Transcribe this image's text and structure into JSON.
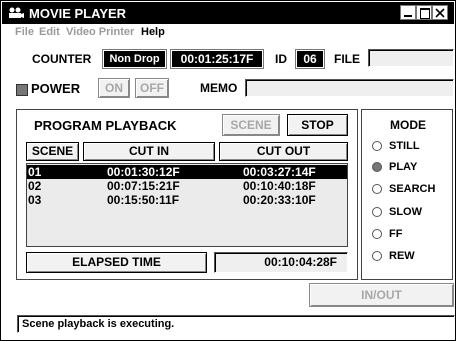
{
  "window": {
    "title": "MOVIE PLAYER"
  },
  "menu": {
    "file": "File",
    "edit": "Edit",
    "video_printer": "Video Printer",
    "help": "Help"
  },
  "counter": {
    "label": "COUNTER",
    "mode": "Non Drop",
    "value": "00:01:25:17F"
  },
  "id": {
    "label": "ID",
    "value": "06"
  },
  "file": {
    "label": "FILE",
    "value": ""
  },
  "power": {
    "label": "POWER",
    "on_label": "ON",
    "off_label": "OFF"
  },
  "memo": {
    "label": "MEMO",
    "value": ""
  },
  "program": {
    "title": "PROGRAM PLAYBACK",
    "scene_button": "SCENE",
    "stop_button": "STOP",
    "columns": {
      "scene": "SCENE",
      "cut_in": "CUT IN",
      "cut_out": "CUT OUT"
    },
    "rows": [
      {
        "scene": "01",
        "cut_in": "00:01:30:12F",
        "cut_out": "00:03:27:14F"
      },
      {
        "scene": "02",
        "cut_in": "00:07:15:21F",
        "cut_out": "00:10:40:18F"
      },
      {
        "scene": "03",
        "cut_in": "00:15:50:11F",
        "cut_out": "00:20:33:10F"
      }
    ],
    "elapsed_label": "ELAPSED TIME",
    "elapsed_value": "00:10:04:28F"
  },
  "mode": {
    "title": "MODE",
    "selected": "PLAY",
    "options": [
      "STILL",
      "PLAY",
      "SEARCH",
      "SLOW",
      "FF",
      "REW"
    ]
  },
  "inout_button": "IN/OUT",
  "status": "Scene playback is executing.",
  "colors": {
    "title_bar": "#000000",
    "selected_row": "#000000",
    "disabled_text": "#a8a8a8"
  },
  "icons": {
    "app": "projector-icon",
    "minimize": "minimize-icon",
    "maximize": "maximize-icon",
    "close": "close-icon"
  }
}
